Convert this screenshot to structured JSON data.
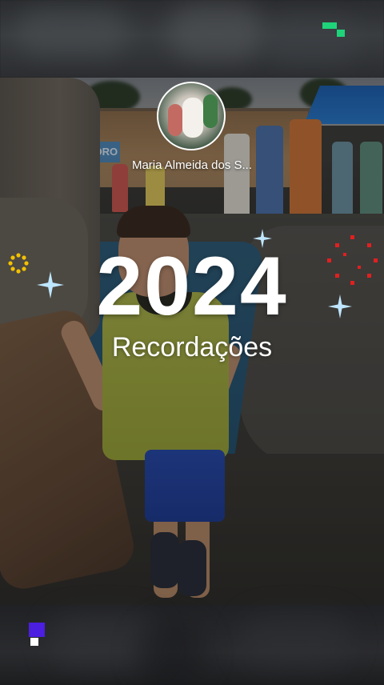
{
  "story": {
    "author_name": "Maria Almeida dos S...",
    "year": "2024",
    "subtitle": "Recordações"
  },
  "scene_sign_text": "PEDRO",
  "colors": {
    "text": "#ffffff",
    "sparkle": "#bfe6ff",
    "gold_dots": "#f2c200",
    "red_dots": "#e02020",
    "brand_green": "#1ed37a",
    "brand_purple": "#4b1ee0"
  },
  "icons": {
    "top_right": "brand-logo-green-icon",
    "bottom_left": "brand-logo-purple-icon"
  }
}
